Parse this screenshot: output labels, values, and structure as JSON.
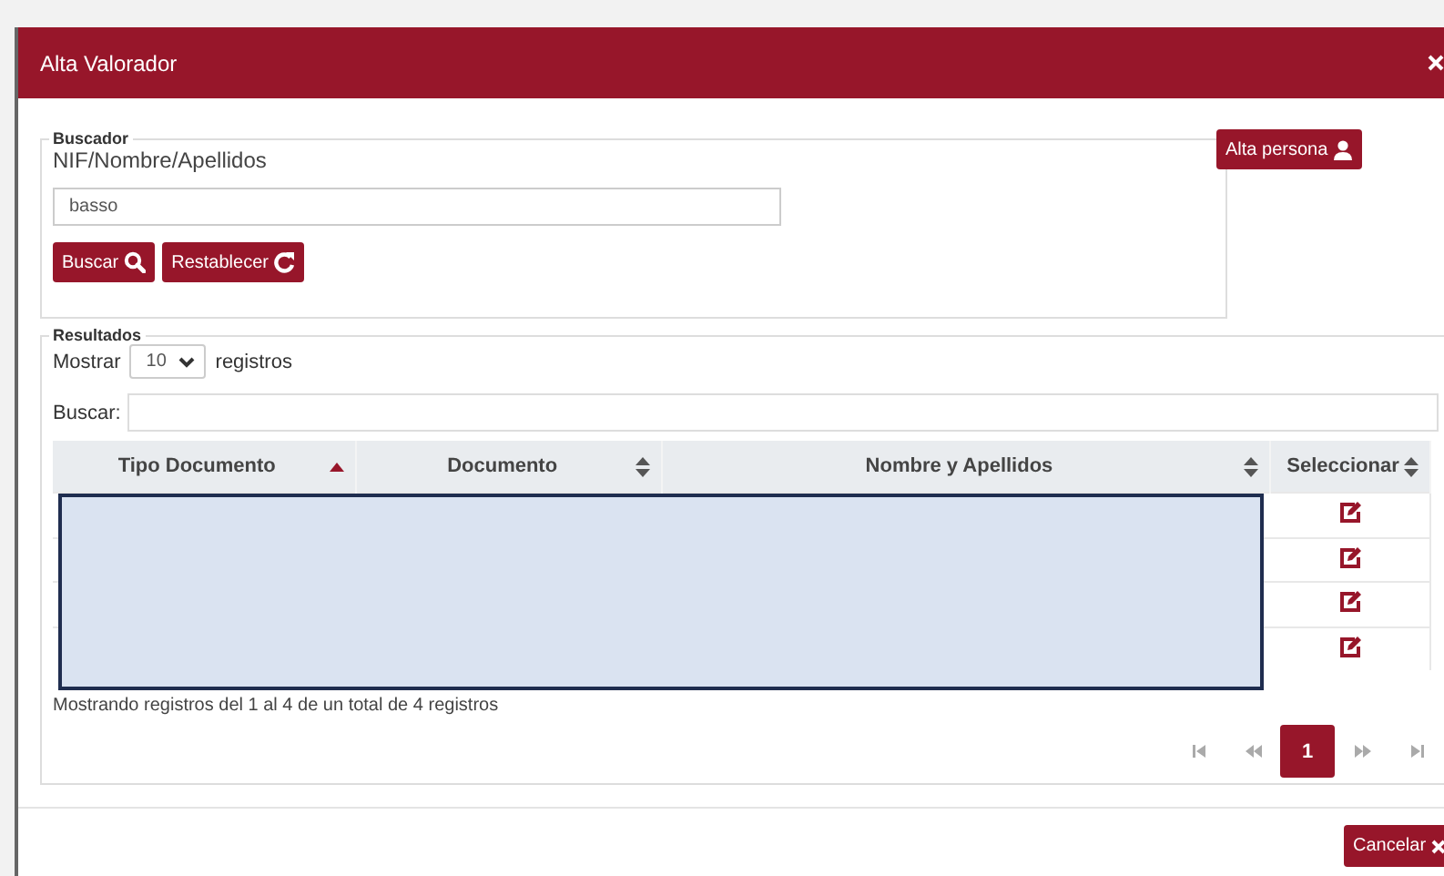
{
  "window": {
    "title": "Alta Valorador"
  },
  "buscador": {
    "legend": "Buscador",
    "field_label": "NIF/Nombre/Apellidos",
    "field_value": "basso",
    "buttons": [
      {
        "label": "Buscar",
        "kind": "search"
      },
      {
        "label": "Restablecer",
        "kind": "reset"
      }
    ]
  },
  "alta_persona_button": {
    "label": "Alta persona"
  },
  "resultados": {
    "legend": "Resultados",
    "show_prefix": "Mostrar",
    "page_size": "10",
    "show_suffix": "registros",
    "search_label": "Buscar:",
    "table": {
      "columns": [
        {
          "label": "Tipo Documento",
          "sorted_ascending": true
        },
        {
          "label": "Documento",
          "sorted_ascending": false
        },
        {
          "label": "Nombre y Apellidos",
          "sorted_ascending": false
        },
        {
          "label": "Seleccionar",
          "sorted_ascending": false
        }
      ],
      "rows": [
        {
          "redacted": true
        },
        {
          "redacted": true
        },
        {
          "redacted": true
        },
        {
          "redacted": true
        }
      ]
    },
    "info": "Mostrando registros del 1 al 4 de un total de 4 registros",
    "pagination": {
      "pages": [
        {
          "label": "1",
          "selected": true
        }
      ]
    }
  },
  "footer": {
    "cancel_button": "Cancelar"
  }
}
